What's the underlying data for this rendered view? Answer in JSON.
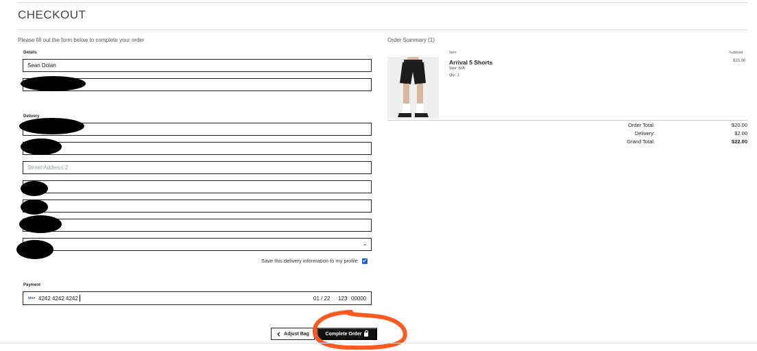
{
  "page": {
    "title": "CHECKOUT",
    "intro": "Please fill out the form below to complete your order"
  },
  "details": {
    "label": "Details",
    "name_value": "Sean Dolan"
  },
  "delivery": {
    "label": "Delivery",
    "street2_placeholder": "Street Address 2",
    "save_label": "Save this delivery information to my profile",
    "save_checked": true
  },
  "payment": {
    "label": "Payment",
    "card_brand": "VISA",
    "card_number": "4242 4242 4242",
    "expiry": "01 / 22",
    "cvc": "123",
    "zip": "00000"
  },
  "actions": {
    "adjust_label": "Adjust Bag",
    "complete_label": "Complete Order"
  },
  "summary": {
    "title": "Order Summary (1)",
    "col_item": "Item",
    "col_subtotal": "Subtotal",
    "product": {
      "name": "Arrival 5 Shorts",
      "size": "Size: N/A",
      "qty": "Qty: 1",
      "price": "$20.00"
    },
    "totals": [
      {
        "label": "Order Total:",
        "value": "$20.00"
      },
      {
        "label": "Delivery:",
        "value": "$2.00"
      },
      {
        "label": "Grand Total:",
        "value": "$22.00"
      }
    ]
  },
  "colors": {
    "accent": "#1a63d6",
    "annotation": "#ff5a1f",
    "button_dark": "#111111"
  },
  "icons": {
    "back": "chevron-left-icon",
    "lock": "lock-icon",
    "select": "chevron-down-icon",
    "check": "checkbox-icon"
  }
}
